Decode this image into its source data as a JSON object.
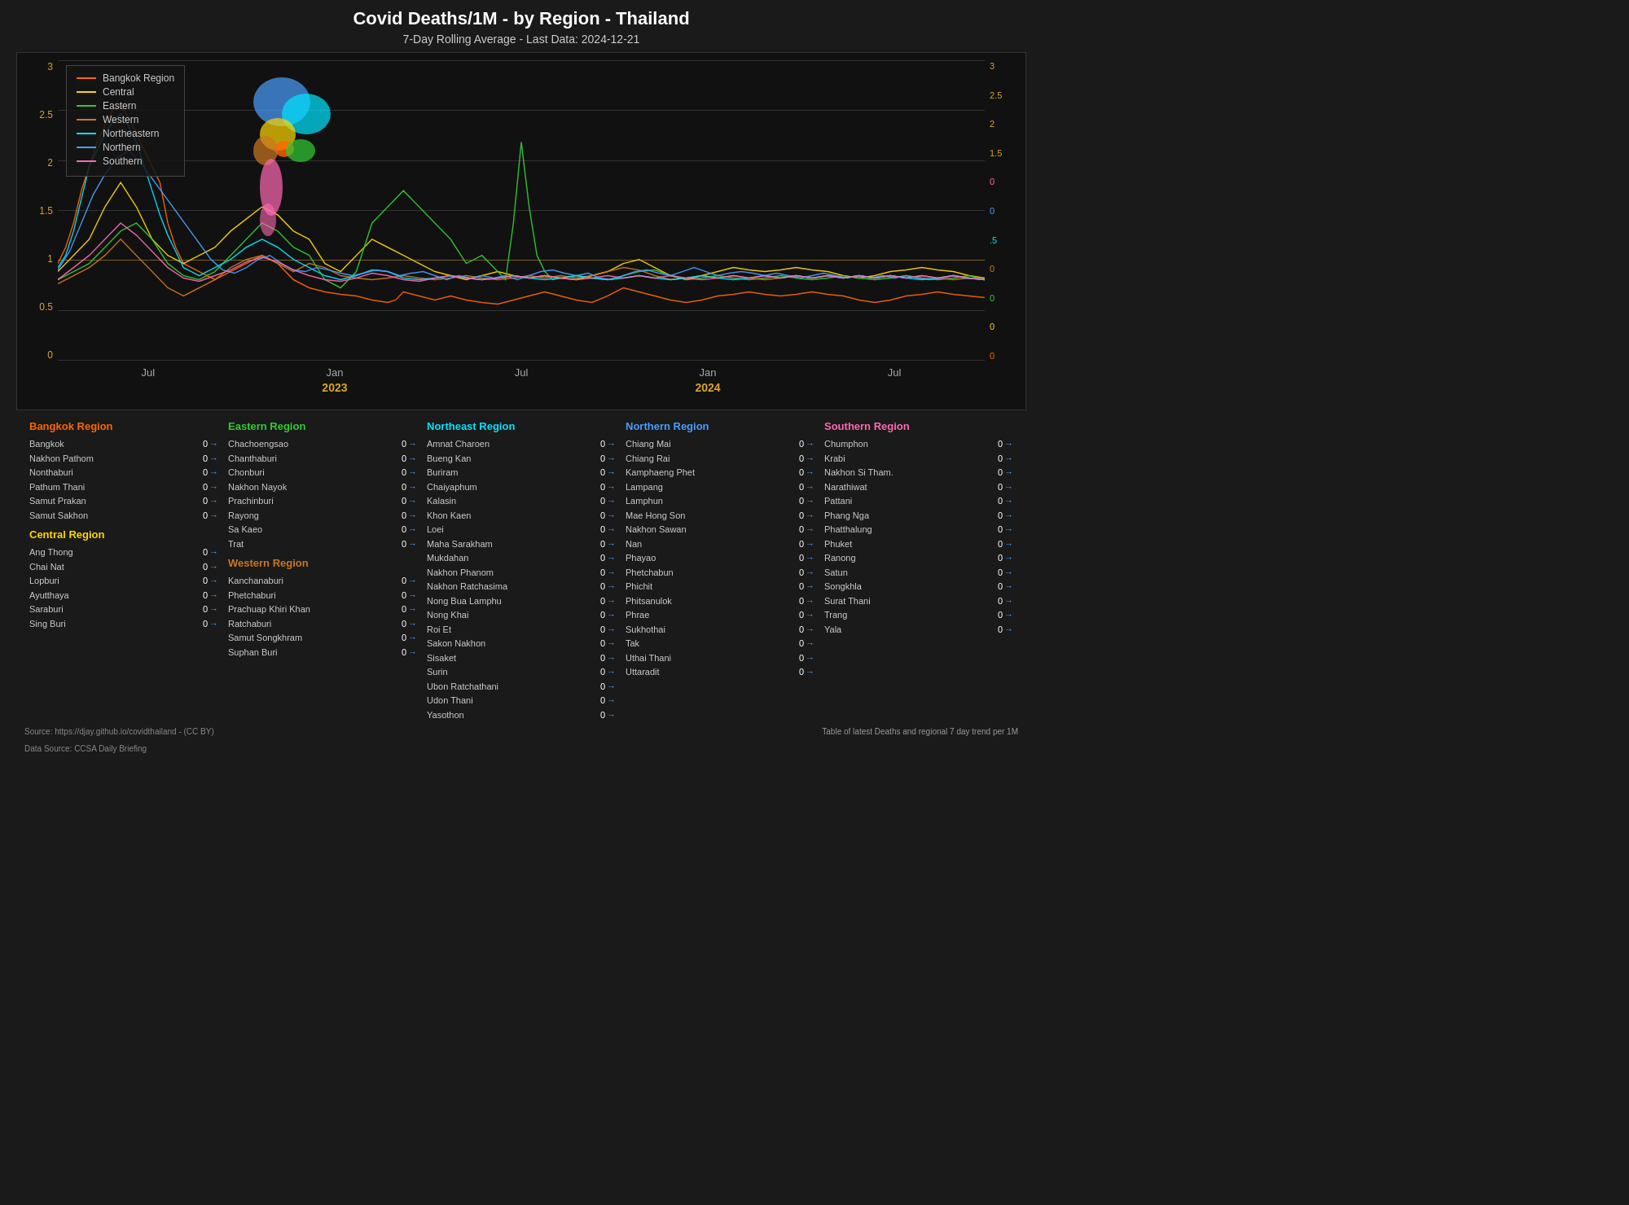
{
  "title": "Covid Deaths/1M - by Region - Thailand",
  "subtitle": "7-Day Rolling Average - Last Data: 2024-12-21",
  "chart": {
    "y_axis_left": [
      "0",
      "0.5",
      "1",
      "1.5",
      "2",
      "2.5",
      "3"
    ],
    "y_axis_right": [
      "0",
      "0",
      "0",
      "0",
      "0",
      ".5",
      "0",
      "1.5",
      "2",
      "2.5",
      "3"
    ],
    "x_labels": [
      {
        "month": "Jul",
        "year": "",
        "sub": ""
      },
      {
        "month": "Jan",
        "year": "2023",
        "sub": ""
      },
      {
        "month": "Jul",
        "year": "",
        "sub": ""
      },
      {
        "month": "Jan",
        "year": "2024",
        "sub": ""
      },
      {
        "month": "Jul",
        "year": "",
        "sub": ""
      }
    ]
  },
  "legend": [
    {
      "label": "Bangkok Region",
      "color": "#ff6600"
    },
    {
      "label": "Central",
      "color": "#ffd700"
    },
    {
      "label": "Eastern",
      "color": "#32cd32"
    },
    {
      "label": "Western",
      "color": "#cc7722"
    },
    {
      "label": "Northeastern",
      "color": "#00e5ff"
    },
    {
      "label": "Northern",
      "color": "#4a9eff"
    },
    {
      "label": "Southern",
      "color": "#ff69b4"
    }
  ],
  "regions": [
    {
      "name": "Bangkok Region",
      "color": "#ff6600",
      "provinces": [
        {
          "name": "Bangkok",
          "val": "0"
        },
        {
          "name": "Nakhon Pathom",
          "val": "0"
        },
        {
          "name": "Nonthaburi",
          "val": "0"
        },
        {
          "name": "Pathum Thani",
          "val": "0"
        },
        {
          "name": "Samut Prakan",
          "val": "0"
        },
        {
          "name": "Samut Sakhon",
          "val": "0"
        }
      ]
    },
    {
      "name": "Eastern Region",
      "color": "#32cd32",
      "provinces": [
        {
          "name": "Chachoengsao",
          "val": "0"
        },
        {
          "name": "Chanthaburi",
          "val": "0"
        },
        {
          "name": "Chonburi",
          "val": "0"
        },
        {
          "name": "Nakhon Nayok",
          "val": "0"
        },
        {
          "name": "Prachinburi",
          "val": "0"
        },
        {
          "name": "Rayong",
          "val": "0"
        },
        {
          "name": "Sa Kaeo",
          "val": "0"
        },
        {
          "name": "Trat",
          "val": "0"
        }
      ]
    },
    {
      "name": "Central Region",
      "color": "#ffd700",
      "provinces": [
        {
          "name": "Ang Thong",
          "val": "0"
        },
        {
          "name": "Chai Nat",
          "val": "0"
        },
        {
          "name": "Lopburi",
          "val": "0"
        },
        {
          "name": "Ayutthaya",
          "val": "0"
        },
        {
          "name": "Saraburi",
          "val": "0"
        },
        {
          "name": "Sing Buri",
          "val": "0"
        }
      ]
    },
    {
      "name": "Western Region",
      "color": "#cc7722",
      "provinces": [
        {
          "name": "Kanchanaburi",
          "val": "0"
        },
        {
          "name": "Phetchaburi",
          "val": "0"
        },
        {
          "name": "Prachuap Khiri Khan",
          "val": "0"
        },
        {
          "name": "Ratchaburi",
          "val": "0"
        },
        {
          "name": "Samut Songkhram",
          "val": "0"
        },
        {
          "name": "Suphan Buri",
          "val": "0"
        }
      ]
    },
    {
      "name": "Northeast Region",
      "color": "#00e5ff",
      "provinces": [
        {
          "name": "Amnat Charoen",
          "val": "0"
        },
        {
          "name": "Bueng Kan",
          "val": "0"
        },
        {
          "name": "Buriram",
          "val": "0"
        },
        {
          "name": "Chaiyaphum",
          "val": "0"
        },
        {
          "name": "Kalasin",
          "val": "0"
        },
        {
          "name": "Khon Kaen",
          "val": "0"
        },
        {
          "name": "Loei",
          "val": "0"
        },
        {
          "name": "Maha Sarakham",
          "val": "0"
        },
        {
          "name": "Mukdahan",
          "val": "0"
        },
        {
          "name": "Nakhon Phanom",
          "val": "0"
        },
        {
          "name": "Nakhon Ratchasima",
          "val": "0"
        },
        {
          "name": "Nong Bua Lamphu",
          "val": "0"
        },
        {
          "name": "Nong Khai",
          "val": "0"
        },
        {
          "name": "Roi Et",
          "val": "0"
        },
        {
          "name": "Sakon Nakhon",
          "val": "0"
        },
        {
          "name": "Sisaket",
          "val": "0"
        },
        {
          "name": "Surin",
          "val": "0"
        },
        {
          "name": "Ubon Ratchathani",
          "val": "0"
        },
        {
          "name": "Udon Thani",
          "val": "0"
        },
        {
          "name": "Yasothon",
          "val": "0"
        }
      ]
    },
    {
      "name": "Northern Region",
      "color": "#4a9eff",
      "provinces": [
        {
          "name": "Chiang Mai",
          "val": "0"
        },
        {
          "name": "Chiang Rai",
          "val": "0"
        },
        {
          "name": "Kamphaeng Phet",
          "val": "0"
        },
        {
          "name": "Lampang",
          "val": "0"
        },
        {
          "name": "Lamphun",
          "val": "0"
        },
        {
          "name": "Mae Hong Son",
          "val": "0"
        },
        {
          "name": "Nakhon Sawan",
          "val": "0"
        },
        {
          "name": "Nan",
          "val": "0"
        },
        {
          "name": "Phayao",
          "val": "0"
        },
        {
          "name": "Phetchabun",
          "val": "0"
        },
        {
          "name": "Phichit",
          "val": "0"
        },
        {
          "name": "Phitsanulok",
          "val": "0"
        },
        {
          "name": "Phrae",
          "val": "0"
        },
        {
          "name": "Sukhothai",
          "val": "0"
        },
        {
          "name": "Tak",
          "val": "0"
        },
        {
          "name": "Uthai Thani",
          "val": "0"
        },
        {
          "name": "Uttaradit",
          "val": "0"
        }
      ]
    },
    {
      "name": "Southern Region",
      "color": "#ff69b4",
      "provinces": [
        {
          "name": "Chumphon",
          "val": "0"
        },
        {
          "name": "Krabi",
          "val": "0"
        },
        {
          "name": "Nakhon Si Tham.",
          "val": "0"
        },
        {
          "name": "Narathiwat",
          "val": "0"
        },
        {
          "name": "Pattani",
          "val": "0"
        },
        {
          "name": "Phang Nga",
          "val": "0"
        },
        {
          "name": "Phatthalung",
          "val": "0"
        },
        {
          "name": "Phuket",
          "val": "0"
        },
        {
          "name": "Ranong",
          "val": "0"
        },
        {
          "name": "Satun",
          "val": "0"
        },
        {
          "name": "Songkhla",
          "val": "0"
        },
        {
          "name": "Surat Thani",
          "val": "0"
        },
        {
          "name": "Trang",
          "val": "0"
        },
        {
          "name": "Yala",
          "val": "0"
        }
      ]
    }
  ],
  "source": "Source: https://djay.github.io/covidthailand - (CC BY)",
  "datasource": "Data Source: CCSA Daily Briefing",
  "table_note": "Table of latest Deaths and regional 7 day trend per 1M"
}
